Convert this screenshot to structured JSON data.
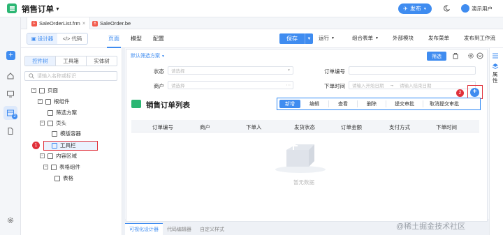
{
  "app": {
    "title": "销售订单",
    "publish": "发布",
    "user": "演示用户"
  },
  "file_tabs": [
    {
      "label": "SaleOrderList.frm",
      "icon": "frm-file-icon"
    },
    {
      "label": "SaleOrder.be",
      "icon": "be-file-icon"
    }
  ],
  "toolbar": {
    "mode_design": "设计器",
    "mode_code": "代码",
    "view_tabs": [
      "页面",
      "模型",
      "配置"
    ],
    "save": "保存",
    "run": "运行",
    "combo_form": "组合表单",
    "external_module": "外部模块",
    "publish_menu": "发布菜单",
    "publish_workflow": "发布到工作流"
  },
  "left_panel": {
    "tabs": [
      "控件树",
      "工具箱",
      "实体树"
    ],
    "search_placeholder": "请输入名称或标识",
    "tree": [
      {
        "label": "页面",
        "toggle": "−"
      },
      {
        "label": "根组件",
        "toggle": "−"
      },
      {
        "label": "筛选方案",
        "toggle": ""
      },
      {
        "label": "页头",
        "toggle": "−"
      },
      {
        "label": "模版容器",
        "toggle": ""
      },
      {
        "label": "工具栏",
        "toggle": ""
      },
      {
        "label": "内容区域",
        "toggle": "−"
      },
      {
        "label": "表格组件",
        "toggle": "−"
      },
      {
        "label": "表格",
        "toggle": ""
      }
    ]
  },
  "form": {
    "filter_plan": "默认筛选方案",
    "filter_button": "筛选",
    "fields": {
      "status_label": "状态",
      "status_placeholder": "请选择",
      "customer_label": "商户",
      "customer_placeholder": "请选择",
      "order_no_label": "订单编号",
      "order_time_label": "下单时间",
      "start_placeholder": "请输入开始日期",
      "end_placeholder": "请输入结束日期",
      "range_arrow": "→"
    },
    "list_title": "销售订单列表",
    "buttons": [
      "新增",
      "编辑",
      "查看",
      "删除",
      "提交审批",
      "取消提交审批"
    ],
    "columns": [
      "订单编号",
      "商户",
      "下单人",
      "发货状态",
      "订单金额",
      "支付方式",
      "下单时间"
    ],
    "empty_text": "暂无数据"
  },
  "markers": [
    "1",
    "2"
  ],
  "right_panel": {
    "label": "属性"
  },
  "bottom_tabs": [
    "可视化设计器",
    "代码编辑器",
    "自定义样式"
  ],
  "watermark": "@稀土掘金技术社区",
  "colors": {
    "primary": "#3f8cf0",
    "brand_green": "#2bb673",
    "highlight_red": "#e0303a"
  }
}
